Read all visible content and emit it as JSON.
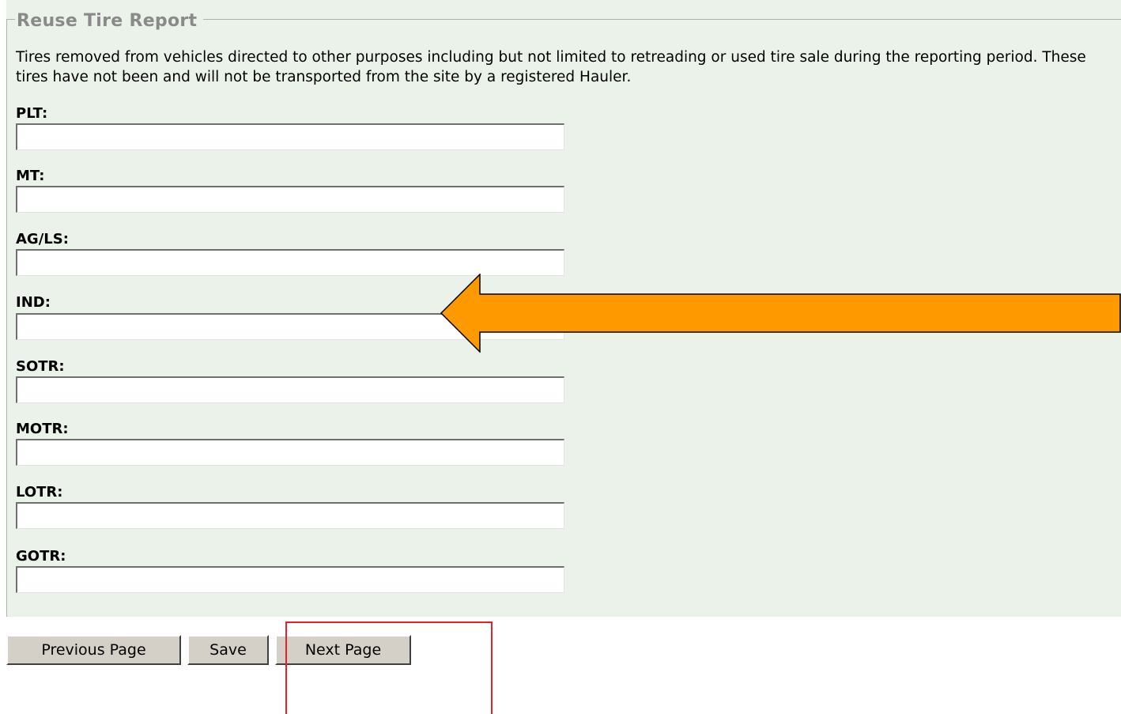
{
  "form": {
    "legend": "Reuse Tire Report",
    "description": "Tires removed from vehicles directed to other purposes including but not limited to retreading or used tire sale during the reporting period. These tires have not been and will not be transported from the site by a registered Hauler.",
    "fields": [
      {
        "label": "PLT:",
        "value": ""
      },
      {
        "label": "MT:",
        "value": ""
      },
      {
        "label": "AG/LS:",
        "value": ""
      },
      {
        "label": "IND:",
        "value": ""
      },
      {
        "label": "SOTR:",
        "value": ""
      },
      {
        "label": "MOTR:",
        "value": ""
      },
      {
        "label": "LOTR:",
        "value": ""
      },
      {
        "label": "GOTR:",
        "value": ""
      }
    ]
  },
  "buttons": {
    "previous": "Previous Page",
    "save": "Save",
    "next": "Next Page"
  },
  "annotations": {
    "arrow_color": "#ff9900",
    "highlight_color": "#e8202a"
  }
}
